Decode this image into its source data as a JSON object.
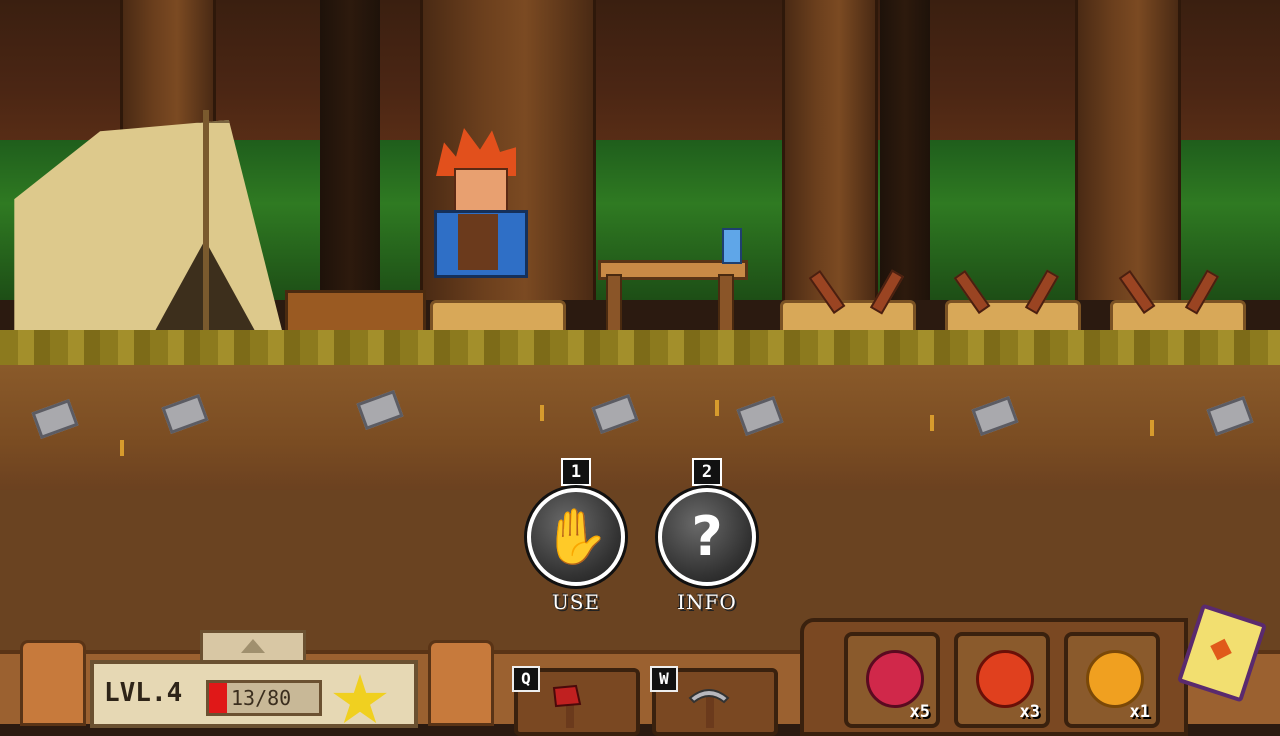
{
  "actions": [
    {
      "key": "1",
      "label": "USE",
      "icon": "hand-icon"
    },
    {
      "key": "2",
      "label": "INFO",
      "icon": "question-icon"
    }
  ],
  "hud": {
    "level_label": "LVL.4",
    "hp_text": "13/80",
    "hp_fraction": 0.1625,
    "skills": [
      {
        "key": "Q",
        "icon": "axe-icon"
      },
      {
        "key": "W",
        "icon": "pickaxe-icon"
      }
    ]
  },
  "inventory": [
    {
      "name": "berries",
      "count": "x5",
      "color": "#d0284a"
    },
    {
      "name": "tomato",
      "count": "x3",
      "color": "#e0401e"
    },
    {
      "name": "pumpkin",
      "count": "x1",
      "color": "#f0a020"
    }
  ],
  "colors": {
    "hp": "#e01818",
    "accent_star": "#f0d020"
  }
}
